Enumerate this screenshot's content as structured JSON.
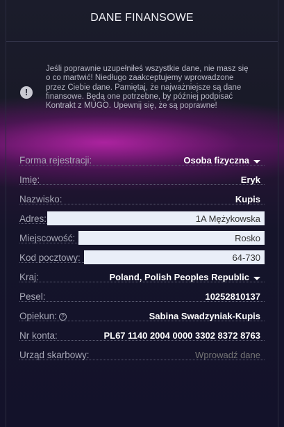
{
  "header": {
    "title": "DANE FINANSOWE"
  },
  "notice": {
    "icon": "exclamation-icon",
    "text": "Jeśli poprawnie uzupełniłeś wszystkie dane, nie masz się o co martwić! Niedługo zaakceptujemy wprowadzone przez Ciebie dane. Pamiętaj, że najważniejsze są dane finansowe. Będą one potrzebne, by później podpisać Kontrakt z MUGO. Upewnij się, że są poprawne!"
  },
  "form": {
    "registration": {
      "label": "Forma rejestracji:",
      "value": "Osoba fizyczna"
    },
    "first_name": {
      "label": "Imię:",
      "value": "Eryk"
    },
    "last_name": {
      "label": "Nazwisko:",
      "value": "Kupis"
    },
    "address": {
      "label": "Adres:",
      "value": "1A Mężykowska"
    },
    "city": {
      "label": "Miejscowość:",
      "value": "Rosko"
    },
    "postal_code": {
      "label": "Kod pocztowy:",
      "value": "64-730"
    },
    "country": {
      "label": "Kraj:",
      "value": "Poland, Polish Peoples Republic"
    },
    "pesel": {
      "label": "Pesel:",
      "value": "10252810137"
    },
    "guardian": {
      "label": "Opiekun:",
      "value": "Sabina Swadzyniak-Kupis",
      "help_icon": "question-circle-icon"
    },
    "account": {
      "label": "Nr konta:",
      "value": "PL67 1140 2004 0000 3302 8372 8763"
    },
    "tax_office": {
      "label": "Urząd skarbowy:",
      "value": "",
      "placeholder": "Wprowadź dane"
    }
  }
}
